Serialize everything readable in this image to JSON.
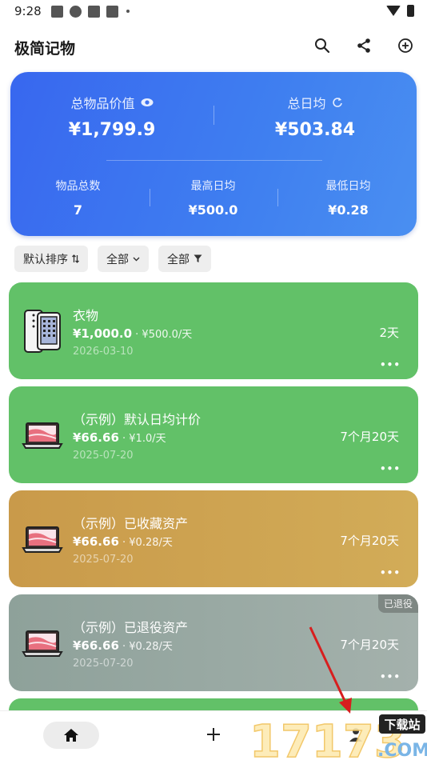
{
  "status": {
    "time": "9:28"
  },
  "app": {
    "title": "极简记物"
  },
  "summary": {
    "total_value_label": "总物品价值",
    "total_value": "¥1,799.9",
    "daily_avg_label": "总日均",
    "daily_avg": "¥503.84",
    "count_label": "物品总数",
    "count": "7",
    "max_label": "最高日均",
    "max": "¥500.0",
    "min_label": "最低日均",
    "min": "¥0.28"
  },
  "filters": {
    "sort": "默认排序",
    "category": "全部",
    "status": "全部"
  },
  "items": [
    {
      "name": "衣物",
      "price": "¥1,000.0",
      "daily": " · ¥500.0/天",
      "date": "2026-03-10",
      "duration": "2天",
      "more": "•••"
    },
    {
      "name": "（示例）默认日均计价",
      "price": "¥66.66",
      "daily": " · ¥1.0/天",
      "date": "2025-07-20",
      "duration": "7个月20天",
      "more": "•••"
    },
    {
      "name": "（示例）已收藏资产",
      "price": "¥66.66",
      "daily": " · ¥0.28/天",
      "date": "2025-07-20",
      "duration": "7个月20天",
      "more": "•••"
    },
    {
      "name": "（示例）已退役资产",
      "price": "¥66.66",
      "daily": " · ¥0.28/天",
      "date": "2025-07-20",
      "duration": "7个月20天",
      "more": "•••",
      "badge": "已退役"
    }
  ],
  "icons": {
    "search": "search-icon",
    "share": "share-icon",
    "add": "add-circle-icon",
    "eye": "eye-icon",
    "refresh": "refresh-icon",
    "home": "home-icon",
    "plus": "plus-icon",
    "profile": "profile-icon"
  },
  "colors": {
    "summary": "#3f7ff0",
    "green": "#62c168",
    "gold": "#cfa653",
    "gray": "#98a8a2",
    "arrow": "#d81e1e"
  },
  "watermark": {
    "number": "17173",
    "tag": "下载站",
    "domain": ".COM"
  }
}
